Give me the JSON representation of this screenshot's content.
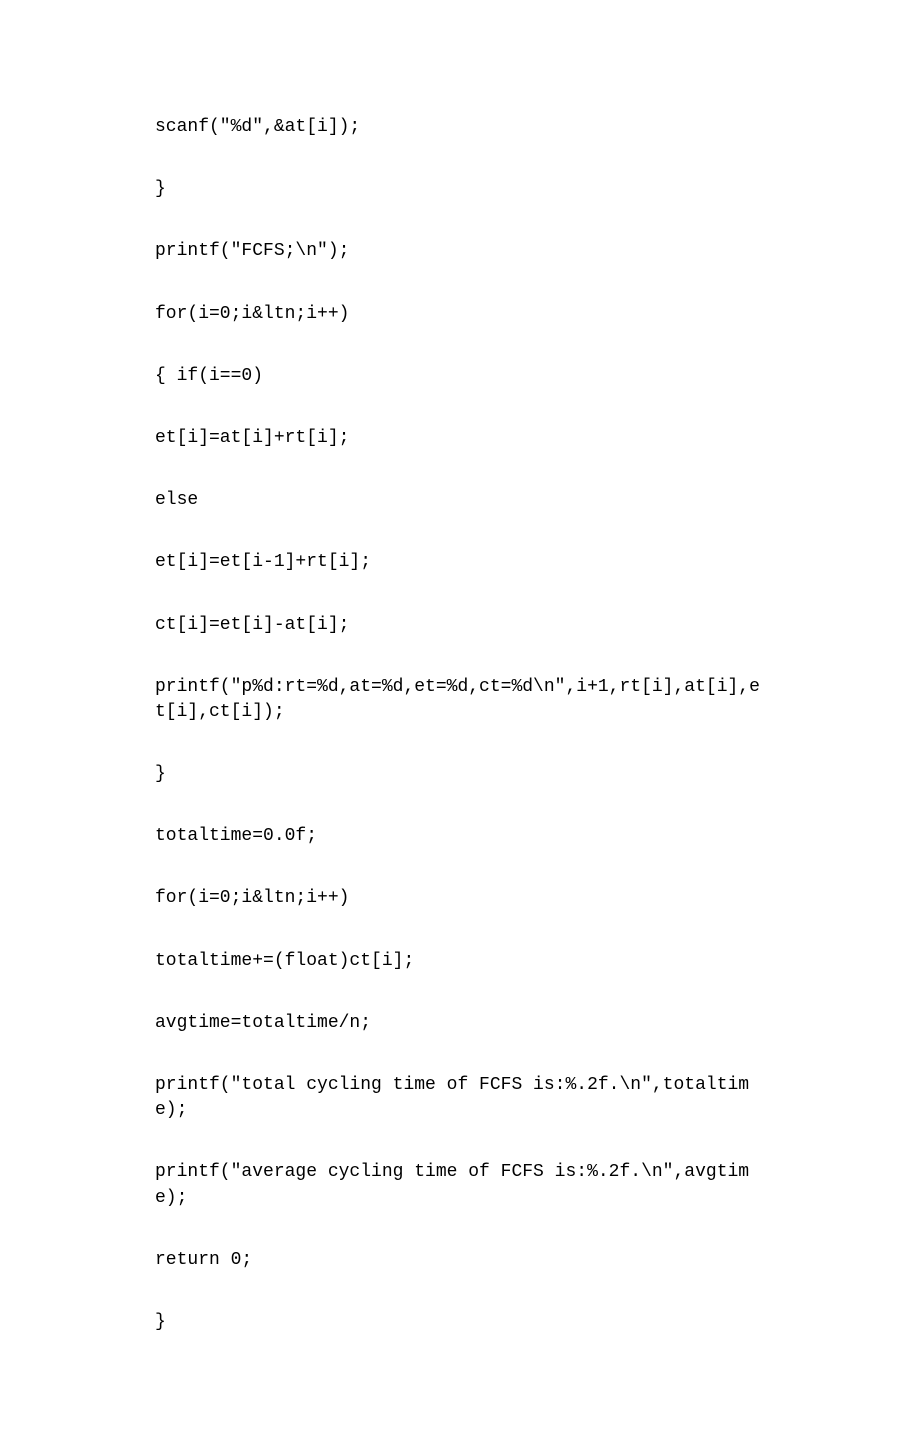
{
  "code": {
    "lines": [
      "scanf(\"%d\",&at[i]);",
      "}",
      "printf(\"FCFS;\\n\");",
      "for(i=0;i&ltn;i++)",
      "{ if(i==0)",
      "et[i]=at[i]+rt[i];",
      "else",
      "et[i]=et[i-1]+rt[i];",
      "ct[i]=et[i]-at[i];",
      "printf(\"p%d:rt=%d,at=%d,et=%d,ct=%d\\n\",i+1,rt[i],at[i],et[i],ct[i]);",
      "}",
      "totaltime=0.0f;",
      "for(i=0;i&ltn;i++)",
      "totaltime+=(float)ct[i];",
      "avgtime=totaltime/n;",
      "printf(\"total cycling time of FCFS is:%.2f.\\n\",totaltime);",
      "printf(\"average cycling time of FCFS is:%.2f.\\n\",avgtime);",
      "return 0;",
      "}"
    ]
  }
}
